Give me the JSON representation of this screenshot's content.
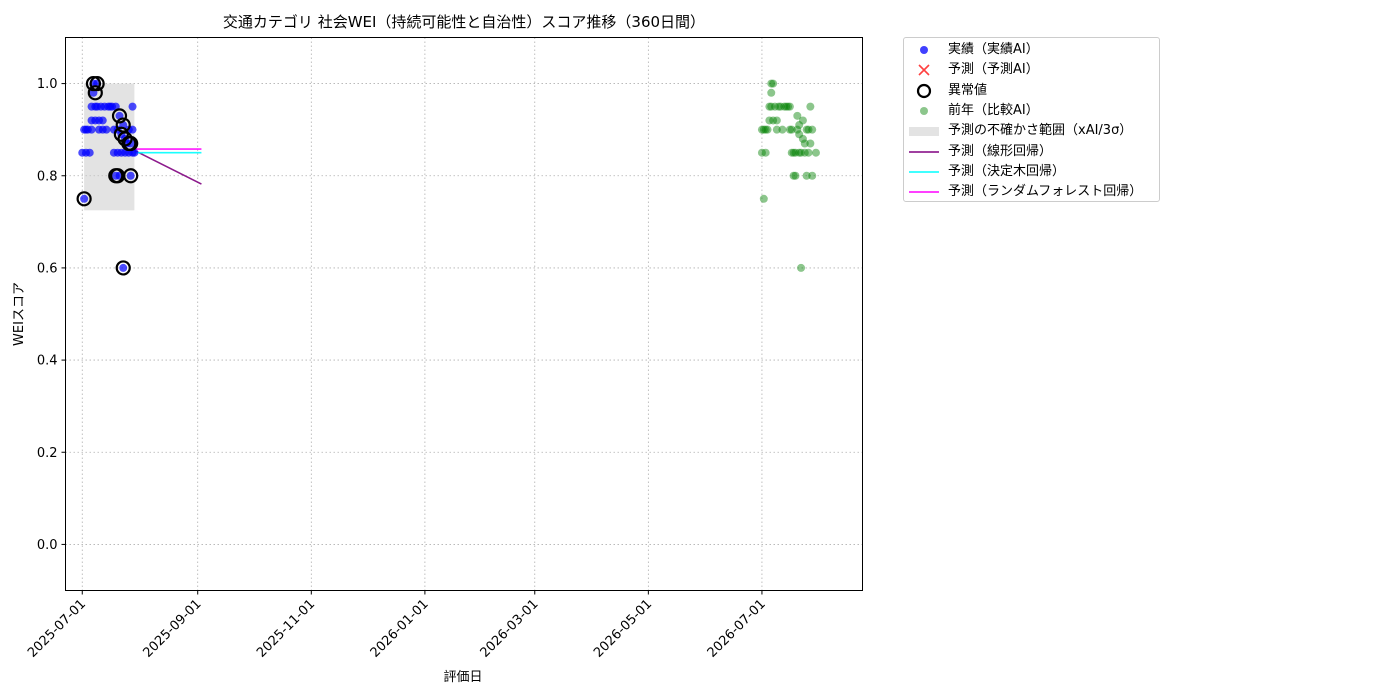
{
  "chart_data": {
    "type": "scatter",
    "title": "交通カテゴリ 社会WEI（持続可能性と自治性）スコア推移（360日間）",
    "xlabel": "評価日",
    "ylabel": "WEIスコア",
    "ylim": [
      -0.1,
      1.1
    ],
    "xlim": [
      "2025-06-22",
      "2026-08-24"
    ],
    "yticks": [
      "0.0",
      "0.2",
      "0.4",
      "0.6",
      "0.8",
      "1.0"
    ],
    "xticks": [
      "2025-07-01",
      "2025-09-01",
      "2025-11-01",
      "2026-01-01",
      "2026-03-01",
      "2026-05-01",
      "2026-07-01"
    ],
    "grid": true,
    "legend_position": "outside-top-right",
    "colors": {
      "actual": "#0000ff",
      "predicted": "#ff0000",
      "anomaly": "#000000",
      "previous_year": "#008000",
      "uncertainty": "#cccccc",
      "linear": "#800080",
      "tree": "#00ffff",
      "forest": "#ff00ff"
    },
    "legend": [
      {
        "key": "actual",
        "label": "実績（実績AI）",
        "symbol": "dot"
      },
      {
        "key": "predicted",
        "label": "予測（予測AI）",
        "symbol": "x"
      },
      {
        "key": "anomaly",
        "label": "異常値",
        "symbol": "ring"
      },
      {
        "key": "previous_year",
        "label": "前年（比較AI）",
        "symbol": "dot"
      },
      {
        "key": "uncertainty",
        "label": "予測の不確かさ範囲（xAI/3σ）",
        "symbol": "band"
      },
      {
        "key": "linear",
        "label": "予測（線形回帰）",
        "symbol": "line"
      },
      {
        "key": "tree",
        "label": "予測（決定木回帰）",
        "symbol": "line"
      },
      {
        "key": "forest",
        "label": "予測（ランダムフォレスト回帰）",
        "symbol": "line"
      }
    ],
    "series": [
      {
        "name": "実績（実績AI）",
        "key": "actual",
        "points": [
          [
            "2025-07-01",
            0.85
          ],
          [
            "2025-07-02",
            0.9
          ],
          [
            "2025-07-02",
            0.75
          ],
          [
            "2025-07-03",
            0.85
          ],
          [
            "2025-07-03",
            0.9
          ],
          [
            "2025-07-04",
            0.9
          ],
          [
            "2025-07-05",
            0.85
          ],
          [
            "2025-07-06",
            0.95
          ],
          [
            "2025-07-06",
            0.92
          ],
          [
            "2025-07-06",
            0.9
          ],
          [
            "2025-07-07",
            1.0
          ],
          [
            "2025-07-07",
            0.98
          ],
          [
            "2025-07-08",
            0.95
          ],
          [
            "2025-07-08",
            0.92
          ],
          [
            "2025-07-09",
            1.0
          ],
          [
            "2025-07-09",
            0.95
          ],
          [
            "2025-07-10",
            0.9
          ],
          [
            "2025-07-10",
            0.92
          ],
          [
            "2025-07-11",
            0.95
          ],
          [
            "2025-07-12",
            0.9
          ],
          [
            "2025-07-12",
            0.92
          ],
          [
            "2025-07-13",
            0.95
          ],
          [
            "2025-07-14",
            0.9
          ],
          [
            "2025-07-15",
            0.95
          ],
          [
            "2025-07-16",
            0.95
          ],
          [
            "2025-07-17",
            0.95
          ],
          [
            "2025-07-18",
            0.85
          ],
          [
            "2025-07-18",
            0.9
          ],
          [
            "2025-07-19",
            0.95
          ],
          [
            "2025-07-19",
            0.8
          ],
          [
            "2025-07-20",
            0.85
          ],
          [
            "2025-07-20",
            0.9
          ],
          [
            "2025-07-21",
            0.8
          ],
          [
            "2025-07-21",
            0.93
          ],
          [
            "2025-07-22",
            0.85
          ],
          [
            "2025-07-22",
            0.89
          ],
          [
            "2025-07-23",
            0.6
          ],
          [
            "2025-07-23",
            0.91
          ],
          [
            "2025-07-24",
            0.85
          ],
          [
            "2025-07-24",
            0.88
          ],
          [
            "2025-07-25",
            0.87
          ],
          [
            "2025-07-26",
            0.85
          ],
          [
            "2025-07-26",
            0.9
          ],
          [
            "2025-07-27",
            0.87
          ],
          [
            "2025-07-27",
            0.8
          ],
          [
            "2025-07-28",
            0.9
          ],
          [
            "2025-07-28",
            0.95
          ],
          [
            "2025-07-28",
            0.85
          ],
          [
            "2025-07-29",
            0.85
          ]
        ]
      },
      {
        "name": "異常値",
        "key": "anomaly",
        "points": [
          [
            "2025-07-02",
            0.75
          ],
          [
            "2025-07-07",
            1.0
          ],
          [
            "2025-07-08",
            0.98
          ],
          [
            "2025-07-09",
            1.0
          ],
          [
            "2025-07-19",
            0.8
          ],
          [
            "2025-07-20",
            0.8
          ],
          [
            "2025-07-21",
            0.93
          ],
          [
            "2025-07-22",
            0.89
          ],
          [
            "2025-07-23",
            0.6
          ],
          [
            "2025-07-23",
            0.91
          ],
          [
            "2025-07-24",
            0.88
          ],
          [
            "2025-07-26",
            0.87
          ],
          [
            "2025-07-27",
            0.87
          ],
          [
            "2025-07-27",
            0.8
          ]
        ]
      },
      {
        "name": "前年（比較AI）",
        "key": "previous_year",
        "points": [
          [
            "2026-07-01",
            0.85
          ],
          [
            "2026-07-01",
            0.9
          ],
          [
            "2026-07-02",
            0.9
          ],
          [
            "2026-07-02",
            0.75
          ],
          [
            "2026-07-03",
            0.85
          ],
          [
            "2026-07-03",
            0.9
          ],
          [
            "2026-07-04",
            0.9
          ],
          [
            "2026-07-05",
            0.95
          ],
          [
            "2026-07-05",
            0.92
          ],
          [
            "2026-07-06",
            1.0
          ],
          [
            "2026-07-06",
            0.98
          ],
          [
            "2026-07-06",
            0.95
          ],
          [
            "2026-07-07",
            1.0
          ],
          [
            "2026-07-07",
            0.92
          ],
          [
            "2026-07-08",
            0.95
          ],
          [
            "2026-07-09",
            0.9
          ],
          [
            "2026-07-09",
            0.92
          ],
          [
            "2026-07-10",
            0.95
          ],
          [
            "2026-07-11",
            0.95
          ],
          [
            "2026-07-12",
            0.9
          ],
          [
            "2026-07-13",
            0.95
          ],
          [
            "2026-07-14",
            0.95
          ],
          [
            "2026-07-15",
            0.95
          ],
          [
            "2026-07-16",
            0.95
          ],
          [
            "2026-07-16",
            0.9
          ],
          [
            "2026-07-17",
            0.85
          ],
          [
            "2026-07-17",
            0.9
          ],
          [
            "2026-07-18",
            0.8
          ],
          [
            "2026-07-18",
            0.85
          ],
          [
            "2026-07-19",
            0.8
          ],
          [
            "2026-07-19",
            0.85
          ],
          [
            "2026-07-20",
            0.9
          ],
          [
            "2026-07-20",
            0.93
          ],
          [
            "2026-07-21",
            0.85
          ],
          [
            "2026-07-21",
            0.89
          ],
          [
            "2026-07-21",
            0.91
          ],
          [
            "2026-07-22",
            0.6
          ],
          [
            "2026-07-22",
            0.85
          ],
          [
            "2026-07-23",
            0.88
          ],
          [
            "2026-07-23",
            0.92
          ],
          [
            "2026-07-24",
            0.85
          ],
          [
            "2026-07-24",
            0.87
          ],
          [
            "2026-07-25",
            0.9
          ],
          [
            "2026-07-25",
            0.8
          ],
          [
            "2026-07-26",
            0.85
          ],
          [
            "2026-07-26",
            0.9
          ],
          [
            "2026-07-27",
            0.95
          ],
          [
            "2026-07-27",
            0.87
          ],
          [
            "2026-07-28",
            0.9
          ],
          [
            "2026-07-28",
            0.8
          ],
          [
            "2026-07-30",
            0.85
          ]
        ]
      }
    ],
    "uncertainty_band": {
      "x": [
        "2025-07-02",
        "2025-07-29"
      ],
      "y": [
        0.725,
        1.0
      ]
    },
    "prediction_lines": [
      {
        "key": "linear",
        "name": "予測（線形回帰）",
        "points": [
          [
            "2025-07-29",
            0.855
          ],
          [
            "2025-09-03",
            0.782
          ]
        ]
      },
      {
        "key": "tree",
        "name": "予測（決定木回帰）",
        "points": [
          [
            "2025-07-29",
            0.85
          ],
          [
            "2025-09-03",
            0.85
          ]
        ]
      },
      {
        "key": "forest",
        "name": "予測（ランダムフォレスト回帰）",
        "points": [
          [
            "2025-07-29",
            0.858
          ],
          [
            "2025-09-03",
            0.858
          ]
        ]
      }
    ]
  }
}
